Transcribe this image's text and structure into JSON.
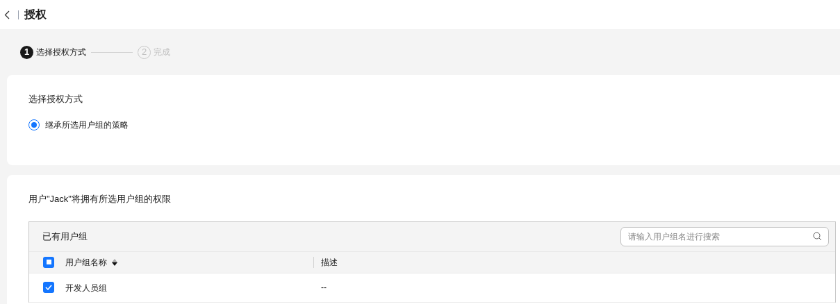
{
  "header": {
    "title": "授权"
  },
  "steps": [
    {
      "number": "1",
      "label": "选择授权方式",
      "selected": true
    },
    {
      "number": "2",
      "label": "完成",
      "selected": false
    }
  ],
  "method_card": {
    "title": "选择授权方式",
    "options": [
      {
        "label": "继承所选用户组的策略",
        "selected": true
      }
    ]
  },
  "groups_card": {
    "description": "用户\"Jack\"将拥有所选用户组的权限",
    "table": {
      "title": "已有用户组",
      "search": {
        "placeholder": "请输入用户组名进行搜索"
      },
      "select_all": {
        "indeterminate": true
      },
      "columns": [
        "用户组名称",
        "描述"
      ],
      "rows": [
        {
          "checked": true,
          "cells": [
            "开发人员组",
            "--"
          ]
        }
      ]
    }
  }
}
